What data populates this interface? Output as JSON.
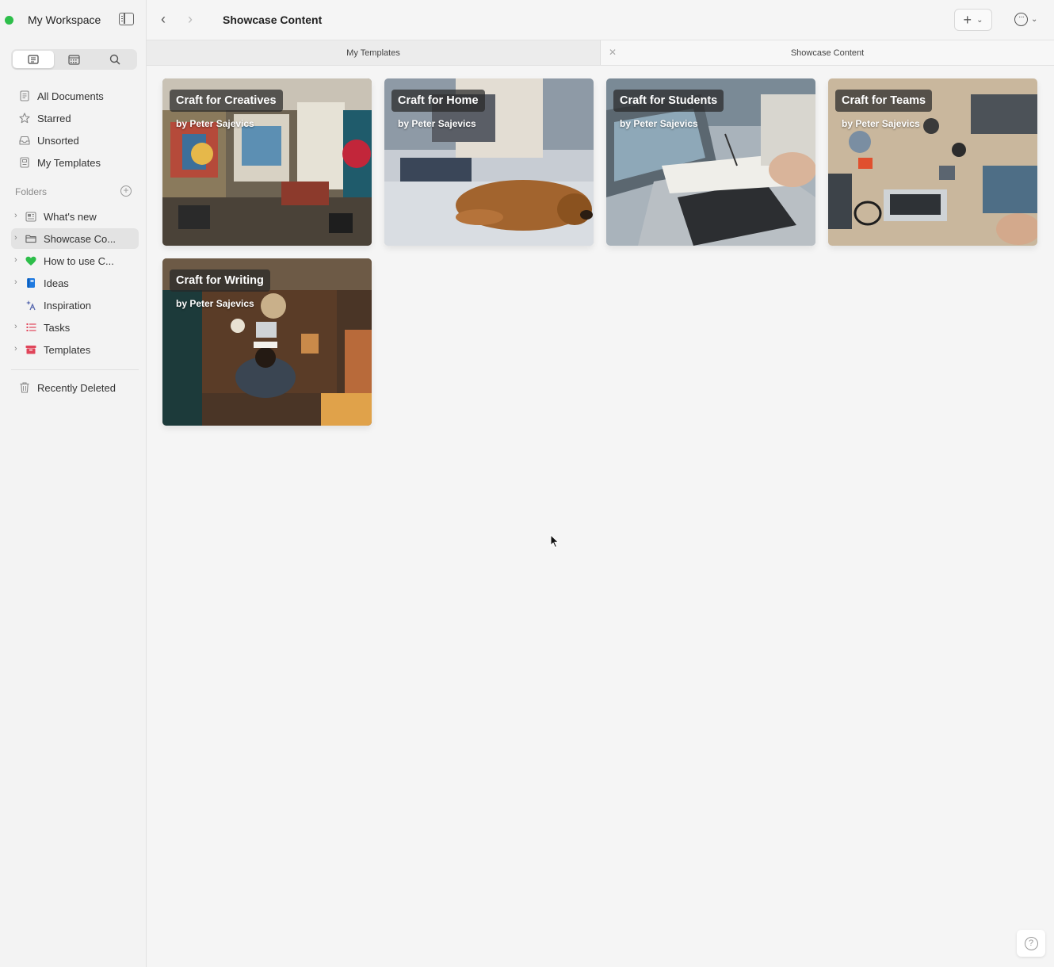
{
  "workspace": {
    "name": "My Workspace",
    "status_color": "#2dbe4a"
  },
  "sidebar": {
    "segments": [
      {
        "icon": "document-icon",
        "active": true
      },
      {
        "icon": "calendar-icon",
        "active": false
      },
      {
        "icon": "search-icon",
        "active": false
      }
    ],
    "nav": [
      {
        "label": "All Documents",
        "icon": "document-stack-icon"
      },
      {
        "label": "Starred",
        "icon": "star-icon"
      },
      {
        "label": "Unsorted",
        "icon": "inbox-icon"
      },
      {
        "label": "My Templates",
        "icon": "template-icon"
      }
    ],
    "folders_label": "Folders",
    "folders": [
      {
        "label": "What's new",
        "icon": "newspaper-icon",
        "color": "#888888",
        "expandable": true
      },
      {
        "label": "Showcase Co...",
        "icon": "folder-icon",
        "color": "#555555",
        "expandable": true,
        "selected": true
      },
      {
        "label": "How to use C...",
        "icon": "heart-icon",
        "color": "#2dbe4a",
        "expandable": true
      },
      {
        "label": "Ideas",
        "icon": "notebook-icon",
        "color": "#1f7ae0",
        "expandable": true
      },
      {
        "label": "Inspiration",
        "icon": "sparkle-icon",
        "color": "#5a6bb0",
        "expandable": false
      },
      {
        "label": "Tasks",
        "icon": "list-icon",
        "color": "#e0455a",
        "expandable": true
      },
      {
        "label": "Templates",
        "icon": "box-icon",
        "color": "#e0455a",
        "expandable": true
      }
    ],
    "recently_deleted": {
      "label": "Recently Deleted",
      "icon": "trash-icon"
    }
  },
  "toolbar": {
    "title": "Showcase Content",
    "add_icon": "plus-icon",
    "more_icon": "ellipsis-circle-icon"
  },
  "tabs": [
    {
      "label": "My Templates",
      "active": false
    },
    {
      "label": "Showcase Content",
      "active": true
    }
  ],
  "cards": [
    {
      "title": "Craft for Creatives",
      "author": "by Peter Sajevics"
    },
    {
      "title": "Craft for Home",
      "author": "by Peter Sajevics"
    },
    {
      "title": "Craft for Students",
      "author": "by Peter Sajevics"
    },
    {
      "title": "Craft for Teams",
      "author": "by Peter Sajevics"
    },
    {
      "title": "Craft for Writing",
      "author": "by Peter Sajevics"
    }
  ],
  "help": {
    "icon": "question-icon"
  }
}
